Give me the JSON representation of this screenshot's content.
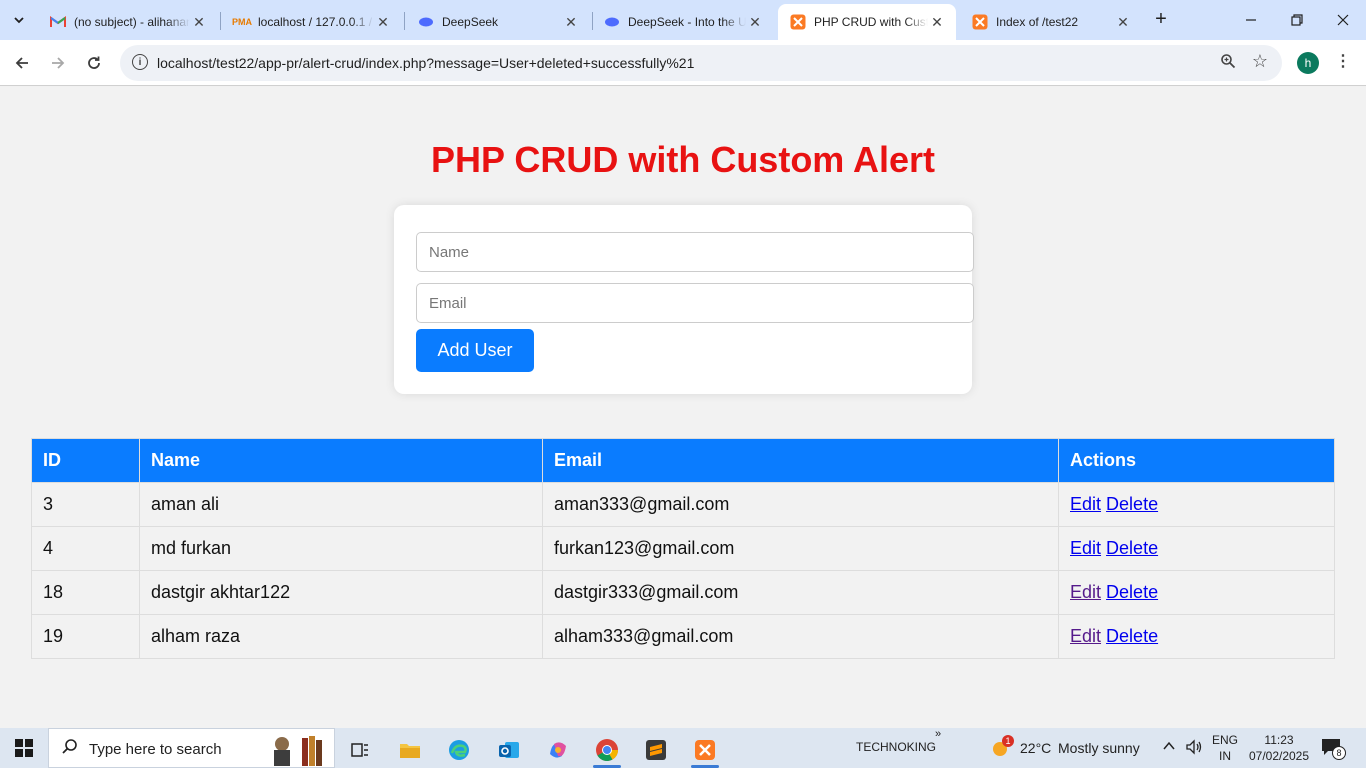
{
  "browser": {
    "tabs": [
      {
        "title": "(no subject) - alihanan",
        "favicon": "gmail-icon",
        "active": false
      },
      {
        "title": "localhost / 127.0.0.1 / ",
        "favicon": "phpmyadmin-icon",
        "active": false
      },
      {
        "title": "DeepSeek",
        "favicon": "deepseek-icon",
        "active": false
      },
      {
        "title": "DeepSeek - Into the Unknown",
        "favicon": "deepseek-icon",
        "active": false
      },
      {
        "title": "PHP CRUD with Custom Alert",
        "favicon": "xampp-icon",
        "active": true
      },
      {
        "title": "Index of /test22",
        "favicon": "xampp-icon",
        "active": false
      }
    ],
    "url": "localhost/test22/app-pr/alert-crud/index.php?message=User+deleted+successfully%21",
    "profile_initial": "h"
  },
  "page": {
    "heading": "PHP CRUD with Custom Alert",
    "form": {
      "name_placeholder": "Name",
      "email_placeholder": "Email",
      "submit_label": "Add User"
    },
    "table": {
      "headers": [
        "ID",
        "Name",
        "Email",
        "Actions"
      ],
      "edit_label": "Edit",
      "delete_label": "Delete",
      "rows": [
        {
          "id": "3",
          "name": "aman ali",
          "email": "aman333@gmail.com"
        },
        {
          "id": "4",
          "name": "md furkan",
          "email": "furkan123@gmail.com"
        },
        {
          "id": "18",
          "name": "dastgir akhtar122",
          "email": "dastgir333@gmail.com"
        },
        {
          "id": "19",
          "name": "alham raza",
          "email": "alham333@gmail.com"
        }
      ]
    }
  },
  "taskbar": {
    "search_placeholder": "Type here to search",
    "user_label": "TECHNOKING",
    "weather_temp": "22°C",
    "weather_desc": "Mostly sunny",
    "weather_badge": "1",
    "lang_line1": "ENG",
    "lang_line2": "IN",
    "time": "11:23",
    "date": "07/02/2025",
    "notification_count": "8"
  },
  "colors": {
    "heading": "#e81212",
    "accent": "#0a7cff",
    "tab_strip": "#d3e3fd"
  }
}
